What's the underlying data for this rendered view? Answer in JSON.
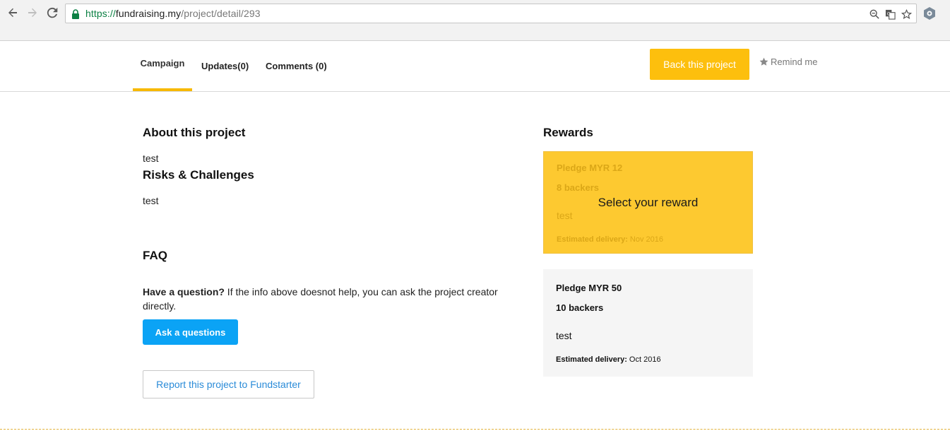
{
  "browser": {
    "url_scheme": "https://",
    "url_host": "fundraising.my",
    "url_path": "/project/detail/293"
  },
  "header": {
    "tabs": [
      {
        "label": "Campaign"
      },
      {
        "label": "Updates(0)"
      },
      {
        "label": "Comments (0)"
      }
    ],
    "back_button": "Back this project",
    "remind": "Remind me"
  },
  "main": {
    "about_title": "About this project",
    "about_text": "test",
    "risks_title": "Risks & Challenges",
    "risks_text": "test",
    "faq_title": "FAQ",
    "faq_question_bold": "Have a question?",
    "faq_question_rest": " If the info above doesnot help, you can ask the project creator directly.",
    "ask_button": "Ask a questions",
    "report_button": "Report this project to Fundstarter"
  },
  "rewards": {
    "title": "Rewards",
    "select_overlay": "Select your reward",
    "items": [
      {
        "pledge": "Pledge MYR 12",
        "backers": "8 backers",
        "description": "test",
        "delivery_label": "Estimated delivery:",
        "delivery_value": " Nov 2016"
      },
      {
        "pledge": "Pledge MYR 50",
        "backers": "10 backers",
        "description": "test",
        "delivery_label": "Estimated delivery:",
        "delivery_value": " Oct 2016"
      }
    ]
  },
  "colors": {
    "accent": "#fdbf0d",
    "ask_button": "#0ba3f5",
    "link": "#2a8bd8",
    "selected_reward": "#fdc930"
  }
}
